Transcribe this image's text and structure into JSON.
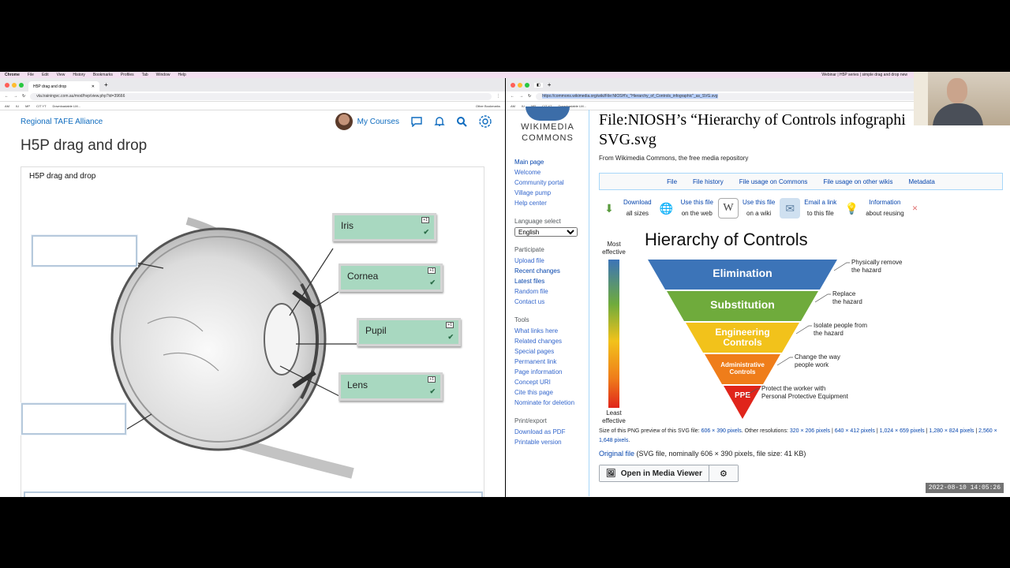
{
  "menubar": {
    "items": [
      "Chrome",
      "File",
      "Edit",
      "View",
      "History",
      "Bookmarks",
      "Profiles",
      "Tab",
      "Window",
      "Help"
    ],
    "right_text": "Webinar | H5P series | simple drag and drop new"
  },
  "left_browser": {
    "tab_title": "H5P drag and drop",
    "url": "vta.trainingvc.com.au/mod/hvp/view.php?id=39666",
    "bookmarks": [
      "AM",
      "IU",
      "MP",
      "CIT YT",
      "Downloadable LM...",
      "Other Bookmarks"
    ],
    "site_name": "Regional TAFE Alliance",
    "my_courses": "My Courses",
    "page_title": "H5P drag and drop",
    "h5p_title": "H5P drag and drop",
    "drag_items": [
      {
        "label": "Iris",
        "badge": "+1"
      },
      {
        "label": "Cornea",
        "badge": "+1"
      },
      {
        "label": "Pupil",
        "badge": "+1"
      },
      {
        "label": "Lens",
        "badge": "+1"
      }
    ]
  },
  "right_browser": {
    "url": "https://commons.wikimedia.org/wiki/File:NIOSH's_\"Hierarchy_of_Controls_infographic\"_as_SVG.svg",
    "bookmarks": [
      "AM",
      "IU",
      "MP",
      "CIT YT",
      "Downloadable LM..."
    ],
    "logo_text_1": "WIKIMEDIA",
    "logo_text_2": "COMMONS",
    "sidebar": {
      "nav": [
        "Main page",
        "Welcome",
        "Community portal",
        "Village pump",
        "Help center"
      ],
      "language_heading": "Language select",
      "language_value": "English",
      "participate_heading": "Participate",
      "participate": [
        "Upload file",
        "Recent changes",
        "Latest files",
        "Random file",
        "Contact us"
      ],
      "tools_heading": "Tools",
      "tools": [
        "What links here",
        "Related changes",
        "Special pages",
        "Permanent link",
        "Page information",
        "Concept URI",
        "Cite this page",
        "Nominate for deletion"
      ],
      "print_heading": "Print/export",
      "print": [
        "Download as PDF",
        "Printable version"
      ]
    },
    "file_title_1": "File:NIOSH’s “Hierarchy of Controls infographi",
    "file_title_2": "SVG.svg",
    "from": "From Wikimedia Commons, the free media repository",
    "file_tabs": [
      "File",
      "File history",
      "File usage on Commons",
      "File usage on other wikis",
      "Metadata"
    ],
    "actions": [
      {
        "line1": "Download",
        "line2": "all sizes",
        "icon": "download-icon"
      },
      {
        "line1": "Use this file",
        "line2": "on the web",
        "icon": "globe-icon"
      },
      {
        "line1": "Use this file",
        "line2": "on a wiki",
        "icon": "wiki-icon"
      },
      {
        "line1": "Email a link",
        "line2": "to this file",
        "icon": "email-icon"
      },
      {
        "line1": "Information",
        "line2": "about reusing",
        "icon": "lightbulb-icon"
      }
    ],
    "figure": {
      "title": "Hierarchy of Controls",
      "most": [
        "Most",
        "effective"
      ],
      "least": [
        "Least",
        "effective"
      ],
      "levels": [
        {
          "name": "Elimination",
          "note": [
            "Physically remove",
            "the hazard"
          ],
          "color": "#3c74b8"
        },
        {
          "name": "Substitution",
          "note": [
            "Replace",
            "the hazard"
          ],
          "color": "#6fab3c"
        },
        {
          "name": "Engineering Controls",
          "note": [
            "Isolate people from",
            "the hazard"
          ],
          "color": "#f2c21b"
        },
        {
          "name": "Administrative Controls",
          "note": [
            "Change the way",
            "people work"
          ],
          "color": "#ef7d1a"
        },
        {
          "name": "PPE",
          "note": [
            "Protect the worker with",
            "Personal Protective Equipment"
          ],
          "color": "#e0251b"
        }
      ]
    },
    "res_prefix": "Size of this PNG preview of this SVG file: ",
    "res_main": "606 × 390 pixels",
    "res_other_label": ". Other resolutions: ",
    "res_other": [
      "320 × 206 pixels",
      "640 × 412 pixels",
      "1,024 × 659 pixels",
      "1,280 × 824 pixels",
      "2,560 × 1,648 pixels"
    ],
    "original_link": "Original file",
    "original_info": " (SVG file, nominally 606 × 390 pixels, file size: 41 KB)",
    "media_viewer": "Open in Media Viewer"
  },
  "timestamp": "2022-08-10 14:05:26"
}
